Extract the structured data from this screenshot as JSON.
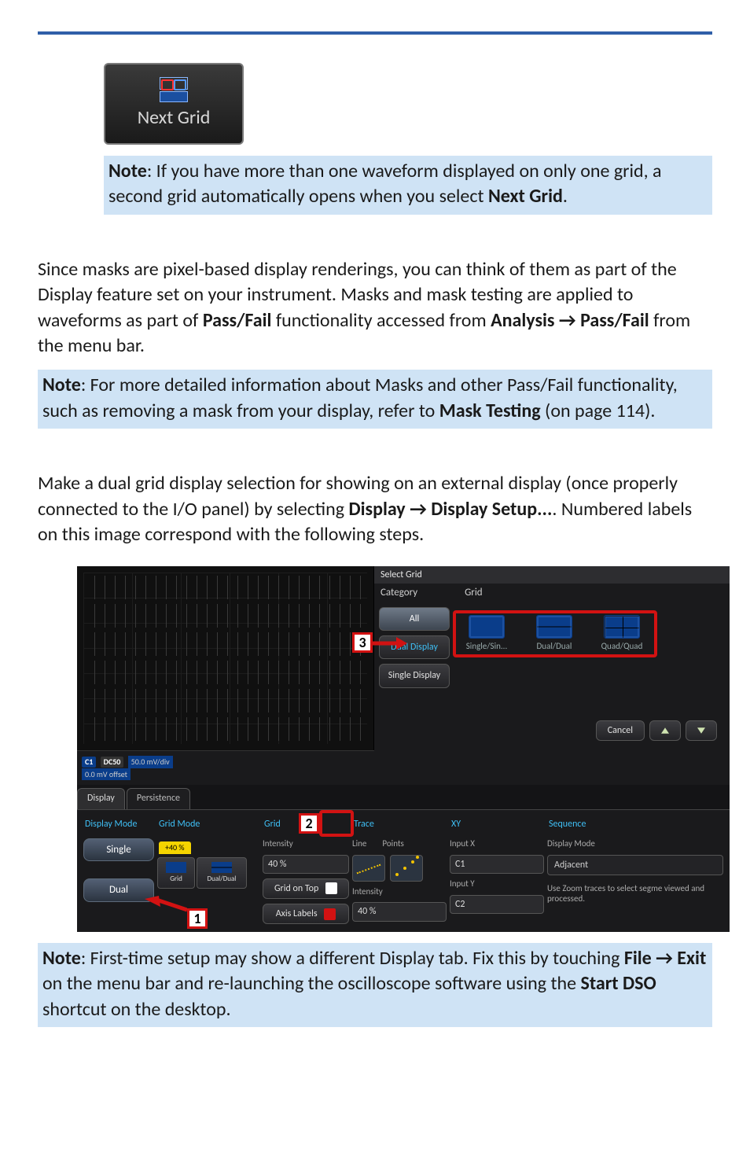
{
  "topRule": true,
  "nextGridTile": {
    "label": "Next Grid"
  },
  "note1": {
    "prefix": "Note",
    "text": ": If you have more than one waveform displayed on only one grid, a second grid automatically opens when you select ",
    "strong": "Next Grid",
    "suffix": "."
  },
  "para1": {
    "a": "Since masks are pixel-based display renderings, you can think of them as part of the Display feature set on your instrument. Masks and mask testing are applied to waveforms as part of ",
    "b": "Pass/Fail",
    "c": " functionality accessed from ",
    "d": "Analysis → Pass/Fail",
    "e": " from the menu bar."
  },
  "note2": {
    "prefix": "Note",
    "a": ": For more detailed information about Masks and other Pass/Fail functionality, such as removing a mask from your display, refer to ",
    "b": "Mask Testing",
    "c": " (on page 114)."
  },
  "para2": {
    "a": "Make a dual grid display selection for showing on an external display (once properly connected to the I/O panel) by selecting ",
    "b": "Display → Display Setup...",
    "c": ". Numbered labels on this image correspond with the following steps."
  },
  "figure": {
    "selectGridTitle": "Select Grid",
    "catHeader": "Category",
    "gridHeader": "Grid",
    "catAll": "All",
    "catDual": "Dual Display",
    "catSingle": "Single Display",
    "optSingle": "Single/Sin...",
    "optDual": "Dual/Dual",
    "optQuad": "Quad/Quad",
    "cancel": "Cancel",
    "chBadge": {
      "c1": "C1",
      "dc50": "DC50",
      "line1": "50.0 mV/div",
      "line2": "0.0 mV offset"
    },
    "tabs": {
      "display": "Display",
      "persistence": "Persistence"
    },
    "panel": {
      "displayMode": "Display Mode",
      "single": "Single",
      "dual": "Dual",
      "gridMode": "Grid Mode",
      "gmGrid": "Grid",
      "gmDualDual": "Dual/Dual",
      "subGrid": "Grid",
      "intensity": "Intensity",
      "intensityVal": "40 %",
      "gridOnTop": "Grid on Top",
      "axisLabels": "Axis Labels",
      "trace": "Trace",
      "traceLine": "Line",
      "tracePoints": "Points",
      "traceIntensity": "Intensity",
      "traceIntensityVal": "40 %",
      "xy": "XY",
      "inputX": "Input X",
      "inputXv": "C1",
      "inputY": "Input Y",
      "inputYv": "C2",
      "sequence": "Sequence",
      "seqDisplayMode": "Display Mode",
      "seqAdjacent": "Adjacent",
      "seqHint": "Use Zoom traces to select segme viewed and processed."
    },
    "callouts": {
      "c1": "1",
      "c2": "2",
      "c3": "3"
    }
  },
  "note3": {
    "prefix": "Note",
    "a": ": First-time setup may show a different Display tab. Fix this by touching ",
    "b": "File → Exit",
    "c": " on the menu bar and re-launching the oscilloscope software using the ",
    "d": "Start DSO",
    "e": " shortcut on the desktop."
  }
}
